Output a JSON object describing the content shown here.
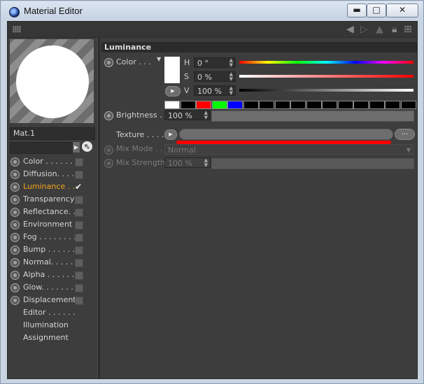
{
  "window": {
    "title": "Material Editor",
    "controls": {
      "minimize": "▬",
      "maximize": "□",
      "close": "✕"
    }
  },
  "material": {
    "name": "Mat.1"
  },
  "channels": [
    {
      "label": "Color . . . . . .",
      "has_radio": true,
      "checked": false,
      "active": false
    },
    {
      "label": "Diffusion. . . .",
      "has_radio": true,
      "checked": false,
      "active": false
    },
    {
      "label": "Luminance . .",
      "has_radio": true,
      "checked": true,
      "active": true
    },
    {
      "label": "Transparency",
      "has_radio": true,
      "checked": false,
      "active": false
    },
    {
      "label": "Reflectance. .",
      "has_radio": true,
      "checked": false,
      "active": false
    },
    {
      "label": "Environment",
      "has_radio": true,
      "checked": false,
      "active": false
    },
    {
      "label": "Fog . . . . . . . .",
      "has_radio": true,
      "checked": false,
      "active": false
    },
    {
      "label": "Bump . . . . . .",
      "has_radio": true,
      "checked": false,
      "active": false
    },
    {
      "label": "Normal. . . . . .",
      "has_radio": true,
      "checked": false,
      "active": false
    },
    {
      "label": "Alpha . . . . . .",
      "has_radio": true,
      "checked": false,
      "active": false
    },
    {
      "label": "Glow. . . . . . .",
      "has_radio": true,
      "checked": false,
      "active": false
    },
    {
      "label": "Displacement",
      "has_radio": true,
      "checked": false,
      "active": false
    },
    {
      "label": "Editor . . . . . .",
      "has_radio": false
    },
    {
      "label": "Illumination",
      "has_radio": false
    },
    {
      "label": "Assignment",
      "has_radio": false
    }
  ],
  "luminance": {
    "section_title": "Luminance",
    "color_label": "Color . . .",
    "h_label": "H",
    "h_value": "0 °",
    "s_label": "S",
    "s_value": "0 %",
    "v_label": "V",
    "v_value": "100 %",
    "swatch_color": "#ffffff",
    "presets": [
      "#ffffff",
      "#000000",
      "#ff0000",
      "#00ff00",
      "#0000ff",
      "#000000",
      "#000000",
      "#000000",
      "#000000",
      "#000000",
      "#000000",
      "#000000",
      "#000000",
      "#000000",
      "#000000",
      "#000000"
    ],
    "brightness_label": "Brightness . .",
    "brightness_value": "100 %",
    "texture_label": "Texture . . . . .",
    "texture_button": "...",
    "mix_mode_label": "Mix Mode . .",
    "mix_mode_value": "Normal",
    "mix_strength_label": "Mix Strength",
    "mix_strength_value": "100 %"
  },
  "colors": {
    "active_channel": "#f1a31b",
    "annotation": "#ff0000",
    "panel": "#3d3d3d"
  }
}
